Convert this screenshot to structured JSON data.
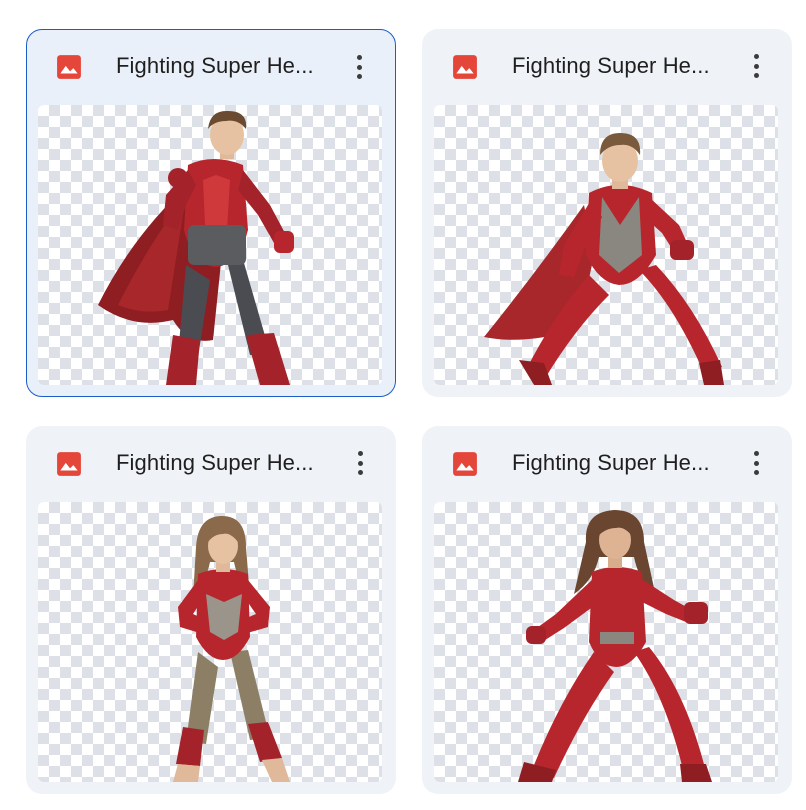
{
  "files": [
    {
      "title": "Fighting Super He...",
      "type_icon": "image-file-icon",
      "selected": true,
      "figure": "boy-caped-hero"
    },
    {
      "title": "Fighting Super He...",
      "type_icon": "image-file-icon",
      "selected": false,
      "figure": "boy-lunging-hero"
    },
    {
      "title": "Fighting Super He...",
      "type_icon": "image-file-icon",
      "selected": false,
      "figure": "girl-standing-hero"
    },
    {
      "title": "Fighting Super He...",
      "type_icon": "image-file-icon",
      "selected": false,
      "figure": "girl-fighting-hero"
    }
  ],
  "colors": {
    "icon_red": "#e5463a",
    "selected_border": "#1a5cc8",
    "card_bg": "#eff2f7"
  }
}
